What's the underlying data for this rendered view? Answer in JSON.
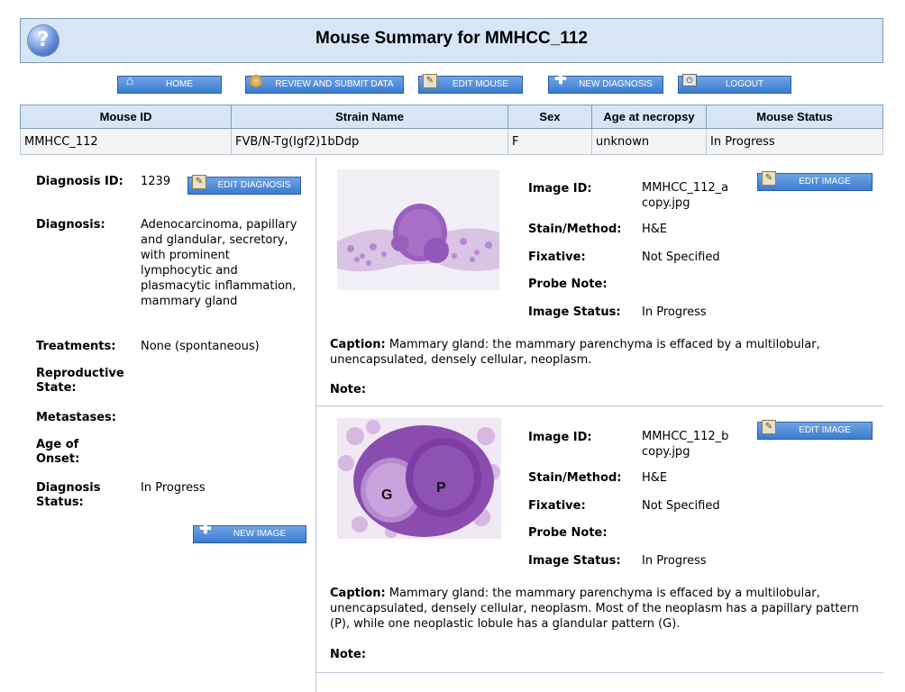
{
  "header": {
    "title": "Mouse Summary for MMHCC_112",
    "help_icon": "?"
  },
  "nav": {
    "home": "HOME",
    "review": "REVIEW AND SUBMIT DATA",
    "edit_mouse": "EDIT MOUSE",
    "new_diagnosis": "NEW DIAGNOSIS",
    "logout": "LOGOUT"
  },
  "mouse_table": {
    "headers": [
      "Mouse ID",
      "Strain Name",
      "Sex",
      "Age at necropsy",
      "Mouse Status"
    ],
    "row": [
      "MMHCC_112",
      "FVB/N-Tg(Igf2)1bDdp",
      "F",
      "unknown",
      "In Progress"
    ]
  },
  "diagnosis": {
    "id_label": "Diagnosis ID:",
    "id_value": "1239",
    "edit_button": "EDIT DIAGNOSIS",
    "diagnosis_label": "Diagnosis:",
    "diagnosis_value": "Adenocarcinoma, papillary and glandular, secretory, with prominent lymphocytic and plasmacytic inflammation, mammary gland",
    "treatments_label": "Treatments:",
    "treatments_value": "None (spontaneous)",
    "repro_label": "Reproductive State:",
    "metastases_label": "Metastases:",
    "onset_label": "Age of Onset:",
    "status_label": "Diagnosis Status:",
    "status_value": "In Progress",
    "new_image_button": "NEW IMAGE"
  },
  "images": [
    {
      "id_label": "Image ID:",
      "id_value": "MMHCC_112_a copy.jpg",
      "stain_label": "Stain/Method:",
      "stain_value": "H&E",
      "fixative_label": "Fixative:",
      "fixative_value": "Not Specified",
      "probe_label": "Probe Note:",
      "status_label": "Image Status:",
      "status_value": "In Progress",
      "edit_button": "EDIT IMAGE",
      "caption_label": "Caption:",
      "caption_value": "Mammary gland: the mammary parenchyma is effaced by a multilobular, unencapsulated, densely cellular, neoplasm.",
      "note_label": "Note:"
    },
    {
      "id_label": "Image ID:",
      "id_value": "MMHCC_112_b copy.jpg",
      "stain_label": "Stain/Method:",
      "stain_value": "H&E",
      "fixative_label": "Fixative:",
      "fixative_value": "Not Specified",
      "probe_label": "Probe Note:",
      "status_label": "Image Status:",
      "status_value": "In Progress",
      "edit_button": "EDIT IMAGE",
      "caption_label": "Caption:",
      "caption_value": "Mammary gland: the mammary parenchyma is effaced by a multilobular, unencapsulated, densely cellular, neoplasm. Most of the neoplasm has a papillary pattern (P), while one neoplastic lobule has a glandular pattern (G).",
      "note_label": "Note:",
      "image_labels": [
        "G",
        "P"
      ]
    }
  ]
}
